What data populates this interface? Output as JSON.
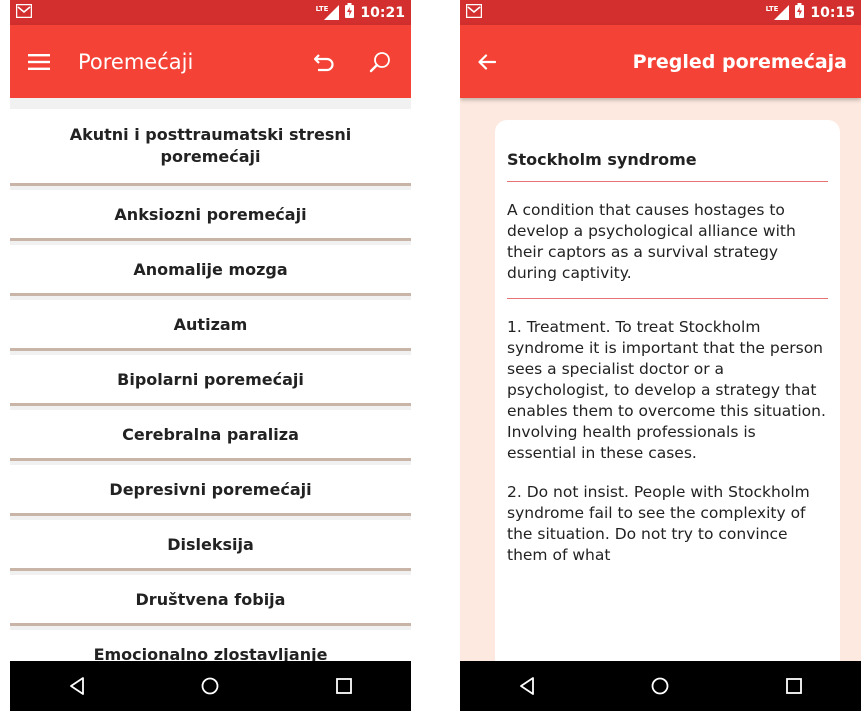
{
  "left_screen": {
    "status_time": "10:21",
    "network_label": "LTE",
    "title": "Poremećaji",
    "list_items": [
      "Akutni i posttraumatski stresni poremećaji",
      "Anksiozni poremećaji",
      "Anomalije mozga",
      "Autizam",
      "Bipolarni poremećaji",
      "Cerebralna paraliza",
      "Depresivni poremećaji",
      "Disleksija",
      "Društvena fobija",
      "Emocionalno zlostavljanje"
    ]
  },
  "right_screen": {
    "status_time": "10:15",
    "network_label": "LTE",
    "title": "Pregled poremećaja",
    "card": {
      "title": "Stockholm syndrome",
      "description": "A condition that causes hostages to develop a psychological alliance with their captors as a survival strategy during captivity.",
      "paragraphs": [
        "1. Treatment. To treat Stockholm syndrome it is important that the person sees a specialist doctor or a psychologist, to develop a strategy that enables them to overcome this situation. Involving health professionals is essential in these cases.",
        "2. Do not insist. People with Stockholm syndrome fail to see the complexity of the situation. Do not try to convince them of what"
      ]
    }
  },
  "colors": {
    "status_bar": "#d32f2f",
    "app_bar": "#f44336",
    "detail_background": "#fde9df",
    "divider": "#e57373"
  },
  "icons": {
    "status_left": "gmail-notification-icon",
    "status_right": [
      "lte-signal-icon",
      "battery-charging-icon"
    ],
    "left_app_bar": [
      "menu-icon",
      "undo-icon",
      "search-icon"
    ],
    "right_app_bar": [
      "back-arrow-icon"
    ],
    "nav_bar": [
      "back-nav-icon",
      "home-nav-icon",
      "recents-nav-icon"
    ]
  }
}
